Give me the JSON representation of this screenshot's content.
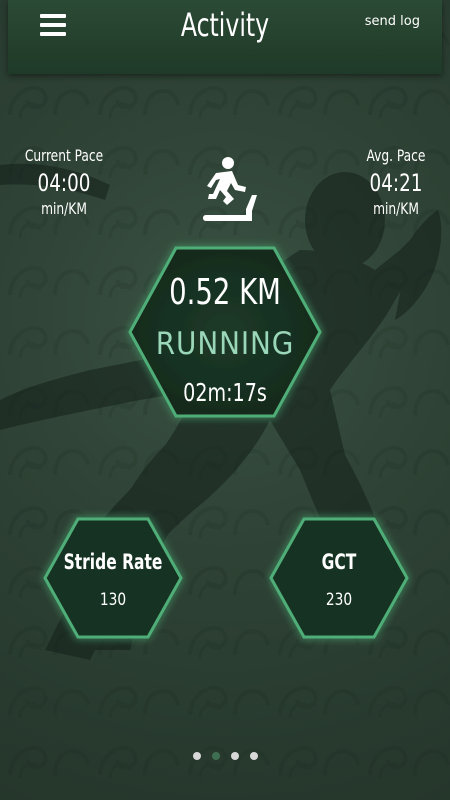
{
  "header": {
    "title": "Activity",
    "send_log_label": "send log",
    "menu_icon": "hamburger-menu-icon"
  },
  "pace": {
    "current": {
      "label": "Current Pace",
      "value": "04:00",
      "unit": "min/KM"
    },
    "average": {
      "label": "Avg. Pace",
      "value": "04:21",
      "unit": "min/KM"
    }
  },
  "activity_icon": "treadmill-runner-icon",
  "main_stat": {
    "distance": "0.52 KM",
    "status": "RUNNING",
    "elapsed": "02m:17s"
  },
  "metrics": [
    {
      "label": "Stride Rate",
      "value": "130"
    },
    {
      "label": "GCT",
      "value": "230"
    }
  ],
  "pager": {
    "count": 4,
    "active_index": 1
  },
  "colors": {
    "background": "#2b3d31",
    "header": "#1f3a28",
    "hex_border": "#4fae78",
    "status_text": "#9ad6b8",
    "active_dot": "#3f6f52"
  }
}
